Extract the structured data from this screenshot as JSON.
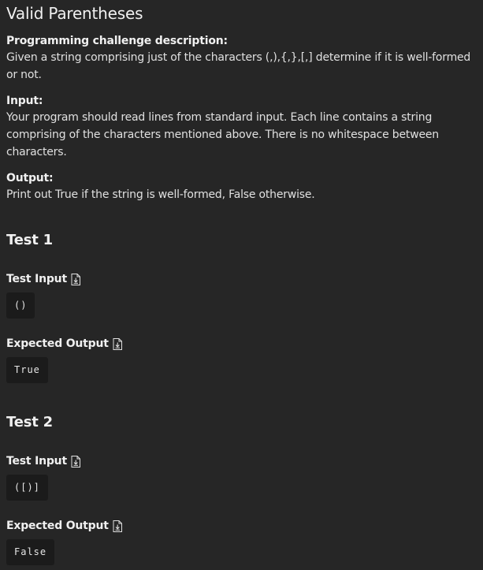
{
  "title": "Valid Parentheses",
  "description": {
    "label": "Programming challenge description:",
    "text": "Given a string comprising just of the characters (,),{,},[,] determine if it is well-formed or not."
  },
  "input": {
    "label": "Input:",
    "text": "Your program should read lines from standard input. Each line contains a string comprising of the characters mentioned above. There is no whitespace between characters."
  },
  "output": {
    "label": "Output:",
    "text": "Print out True if the string is well-formed, False otherwise."
  },
  "tests": [
    {
      "heading": "Test 1",
      "input_label": "Test Input",
      "input_value": "()",
      "output_label": "Expected Output",
      "output_value": "True"
    },
    {
      "heading": "Test 2",
      "input_label": "Test Input",
      "input_value": "([)]",
      "output_label": "Expected Output",
      "output_value": "False"
    }
  ],
  "icons": {
    "download": "download-file-icon"
  },
  "colors": {
    "background": "#262626",
    "code_background": "#1b1b1b",
    "text": "#e3e3e3"
  }
}
